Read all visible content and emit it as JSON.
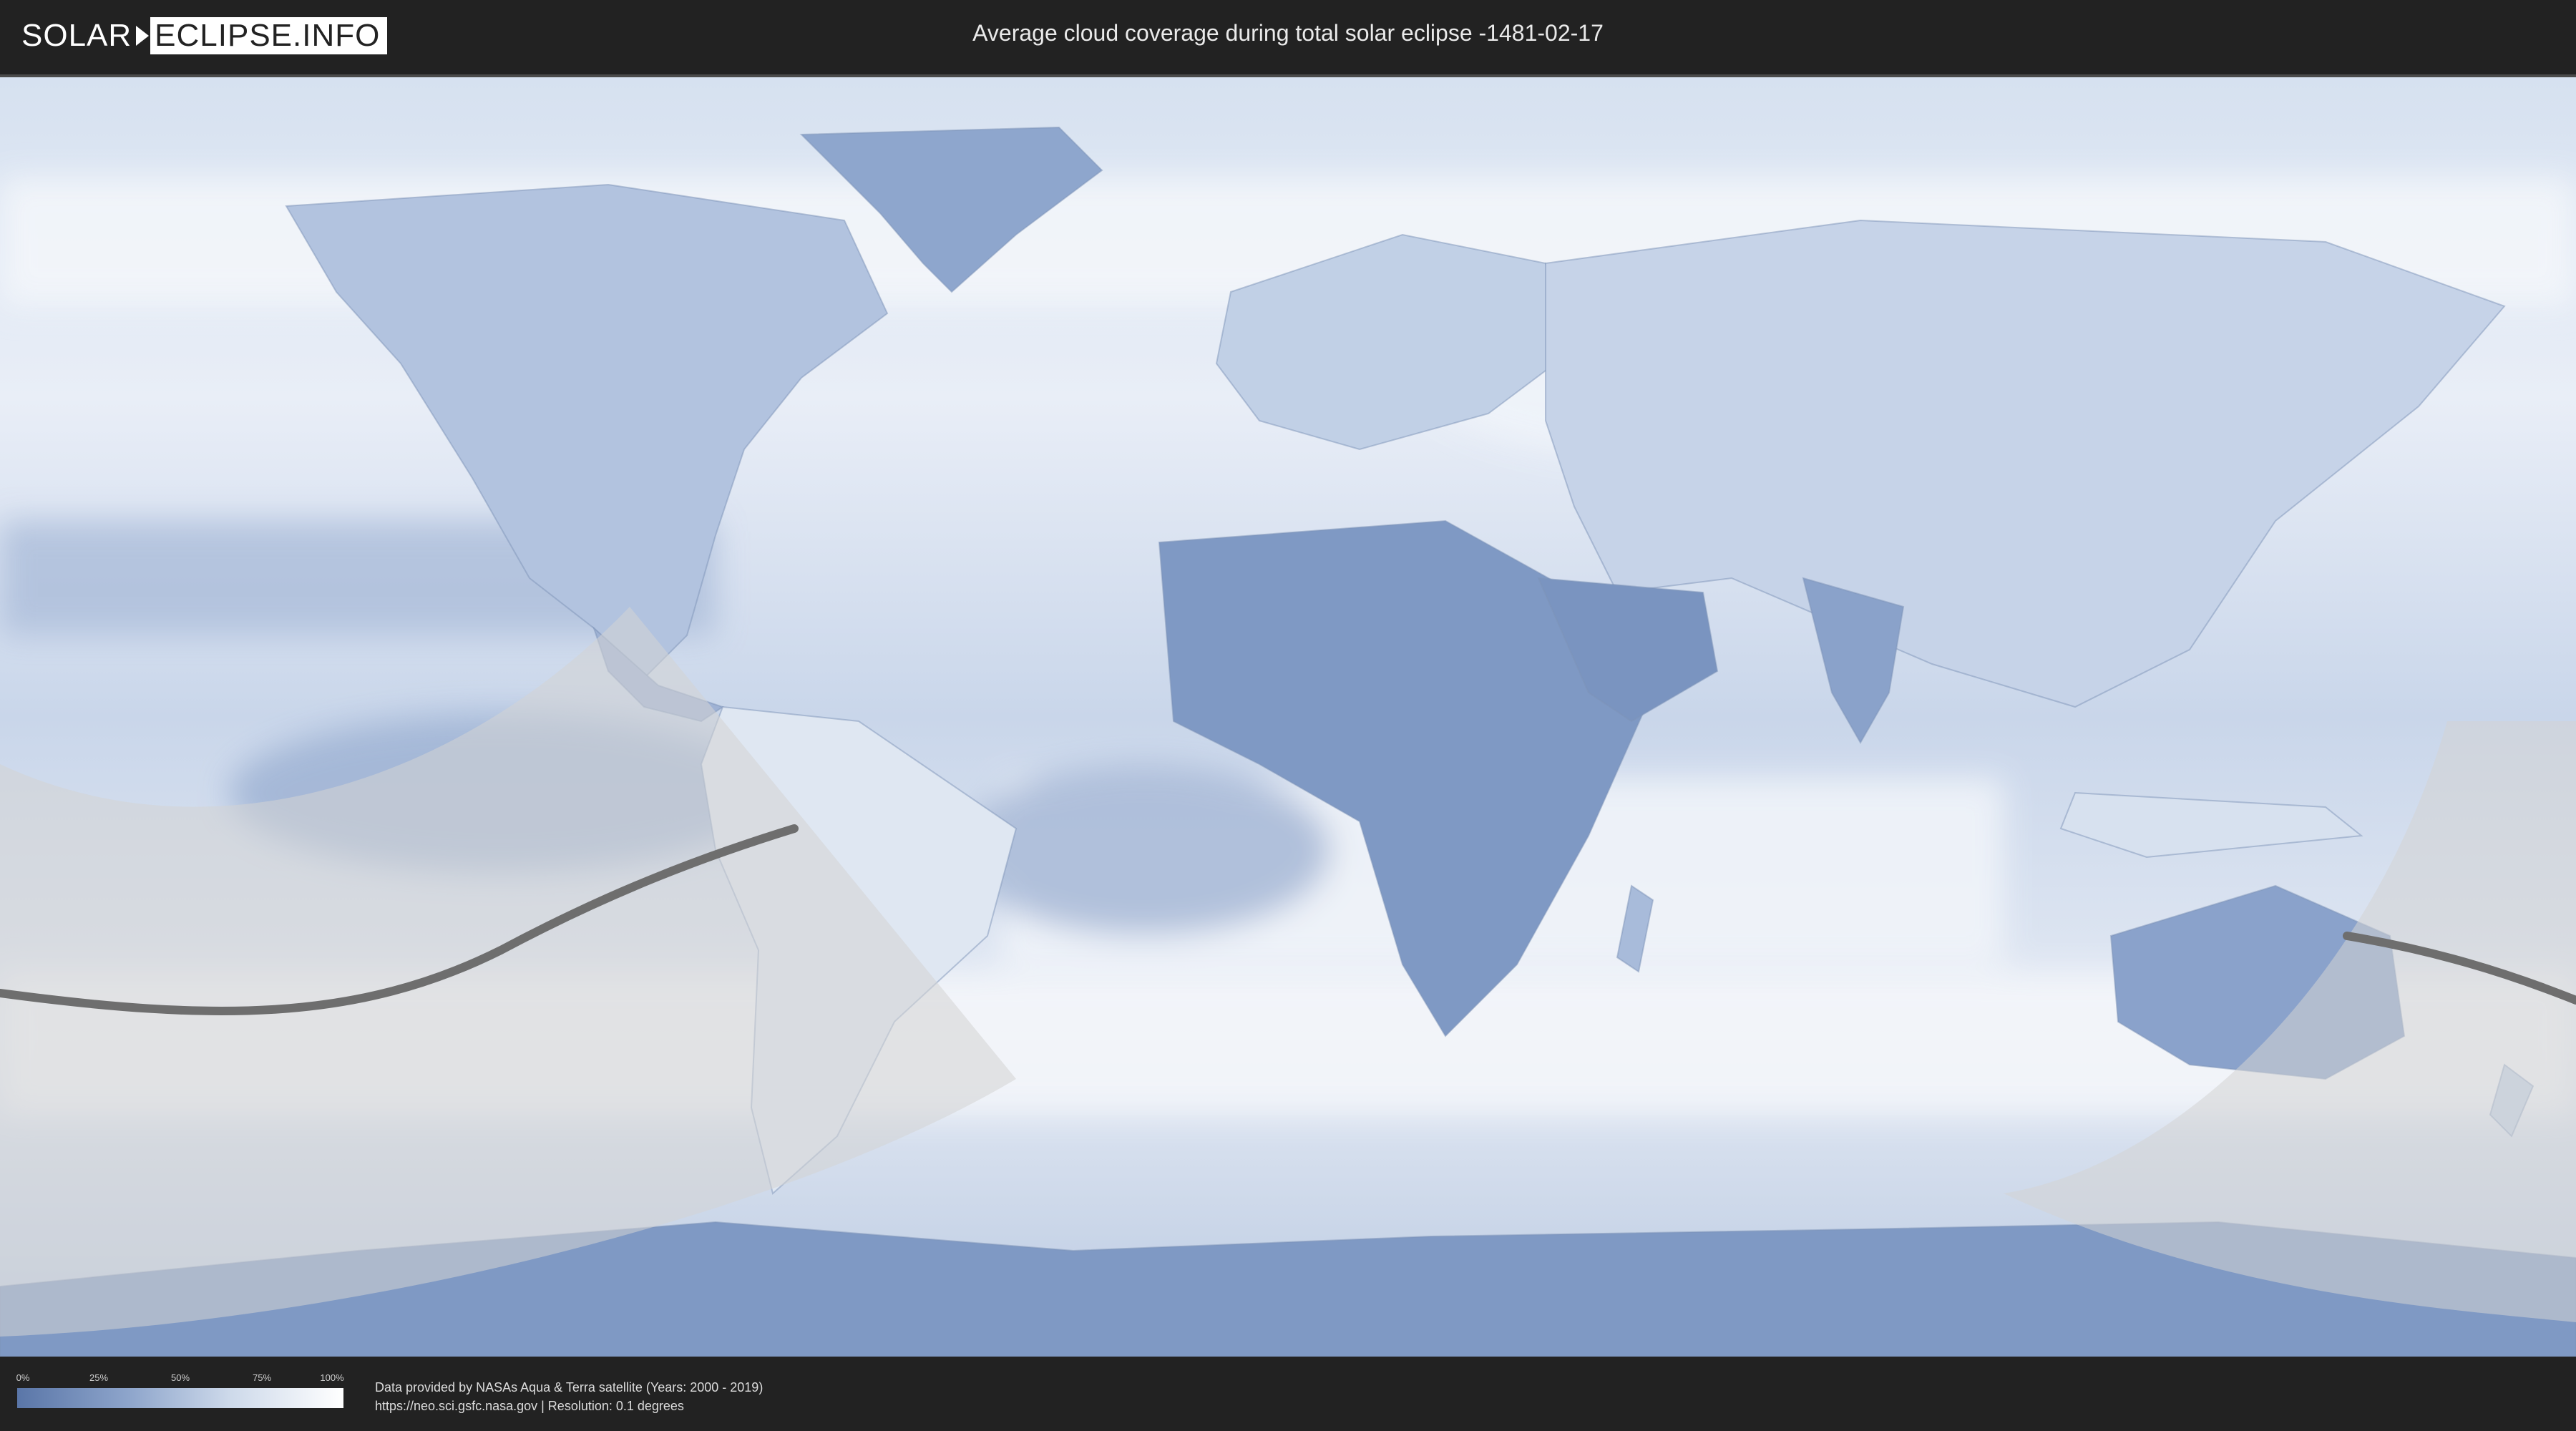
{
  "header": {
    "logo_left": "SOLAR",
    "logo_right": "ECLIPSE.INFO",
    "title": "Average cloud coverage during total solar eclipse -1481-02-17"
  },
  "legend": {
    "ticks": [
      "0%",
      "25%",
      "50%",
      "75%",
      "100%"
    ],
    "values": [
      0,
      25,
      50,
      75,
      100
    ],
    "color_low": "#5a76a8",
    "color_high": "#ffffff"
  },
  "credits": {
    "line1": "Data provided by NASAs Aqua & Terra satellite (Years: 2000 - 2019)",
    "line2": "https://neo.sci.gsfc.nasa.gov | Resolution: 0.1 degrees"
  },
  "colors": {
    "page_background": "#222222",
    "ocean_cloud": "#c8d6ea",
    "land": "#7f99c4",
    "eclipse_zone": "#cfcfcf",
    "central_line": "#6e6e6e"
  }
}
